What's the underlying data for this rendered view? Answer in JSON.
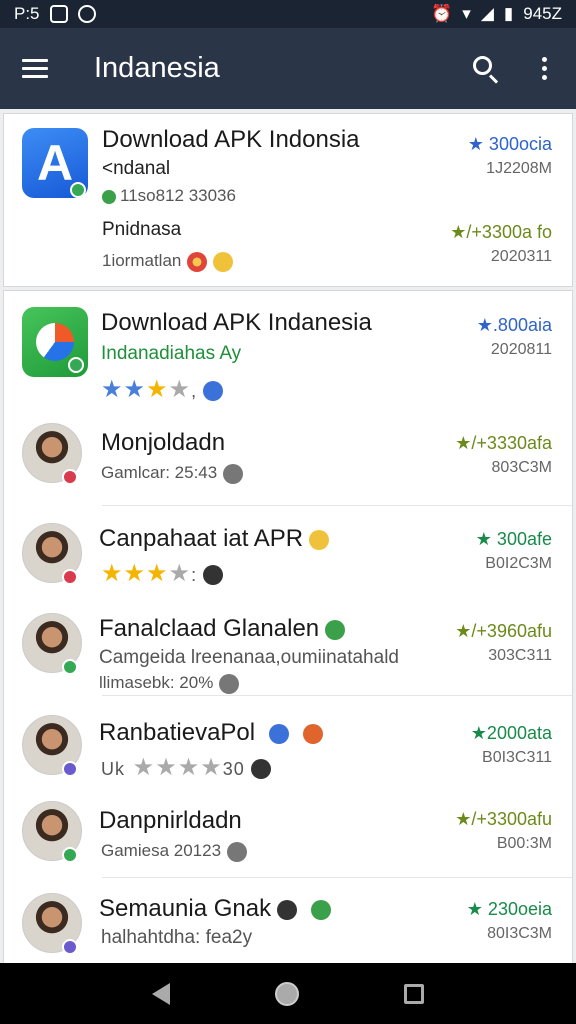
{
  "status_bar": {
    "time": "P:5",
    "battery": "945Z"
  },
  "app_bar": {
    "title": "Indanesia"
  },
  "cards": [
    {
      "title": "Download APK Indonsia",
      "subtitle": "<ndanal",
      "meta1": "11so812 33036",
      "subtitle2": "Pnidnasa",
      "meta2": "1iormatlan",
      "stat1": "★ 300ocia",
      "size1": "1J2208M",
      "stat2": "★/+3300a fo",
      "size2": "2020311"
    },
    {
      "title": "Download APK Indanesia",
      "subtitle": "Indanadiahas Ay",
      "stat1": "★.800aia",
      "size1": "2020811"
    }
  ],
  "list": [
    {
      "title": "Monjoldadn",
      "meta": "Gamlcar: 25:43",
      "stat": "★/+3330afa",
      "size": "803C3M"
    },
    {
      "title": "Canpahaat iat APR",
      "stat": "★ 300afe",
      "size": "B0I2C3M"
    },
    {
      "title": "Fanalclaad Glanalen",
      "sub": "Camgeida lreenanaa,oumiinatahald",
      "meta": "llimasebk: 20%",
      "stat": "★/+3960afu",
      "size": "303C311"
    },
    {
      "title": "RanbatievaPol",
      "prefix": "Uk",
      "rating": "30",
      "stat": "★2000ata",
      "size": "B0I3C311"
    },
    {
      "title": "Danpnirldadn",
      "meta": "Gamiesa 20123",
      "stat": "★/+3300afu",
      "size": "B00:3M"
    },
    {
      "title": "Semaunia Gnak",
      "sub": "halhahtdha: fea2y",
      "stat": "★ 230oeia",
      "size": "80I3C3M"
    }
  ]
}
